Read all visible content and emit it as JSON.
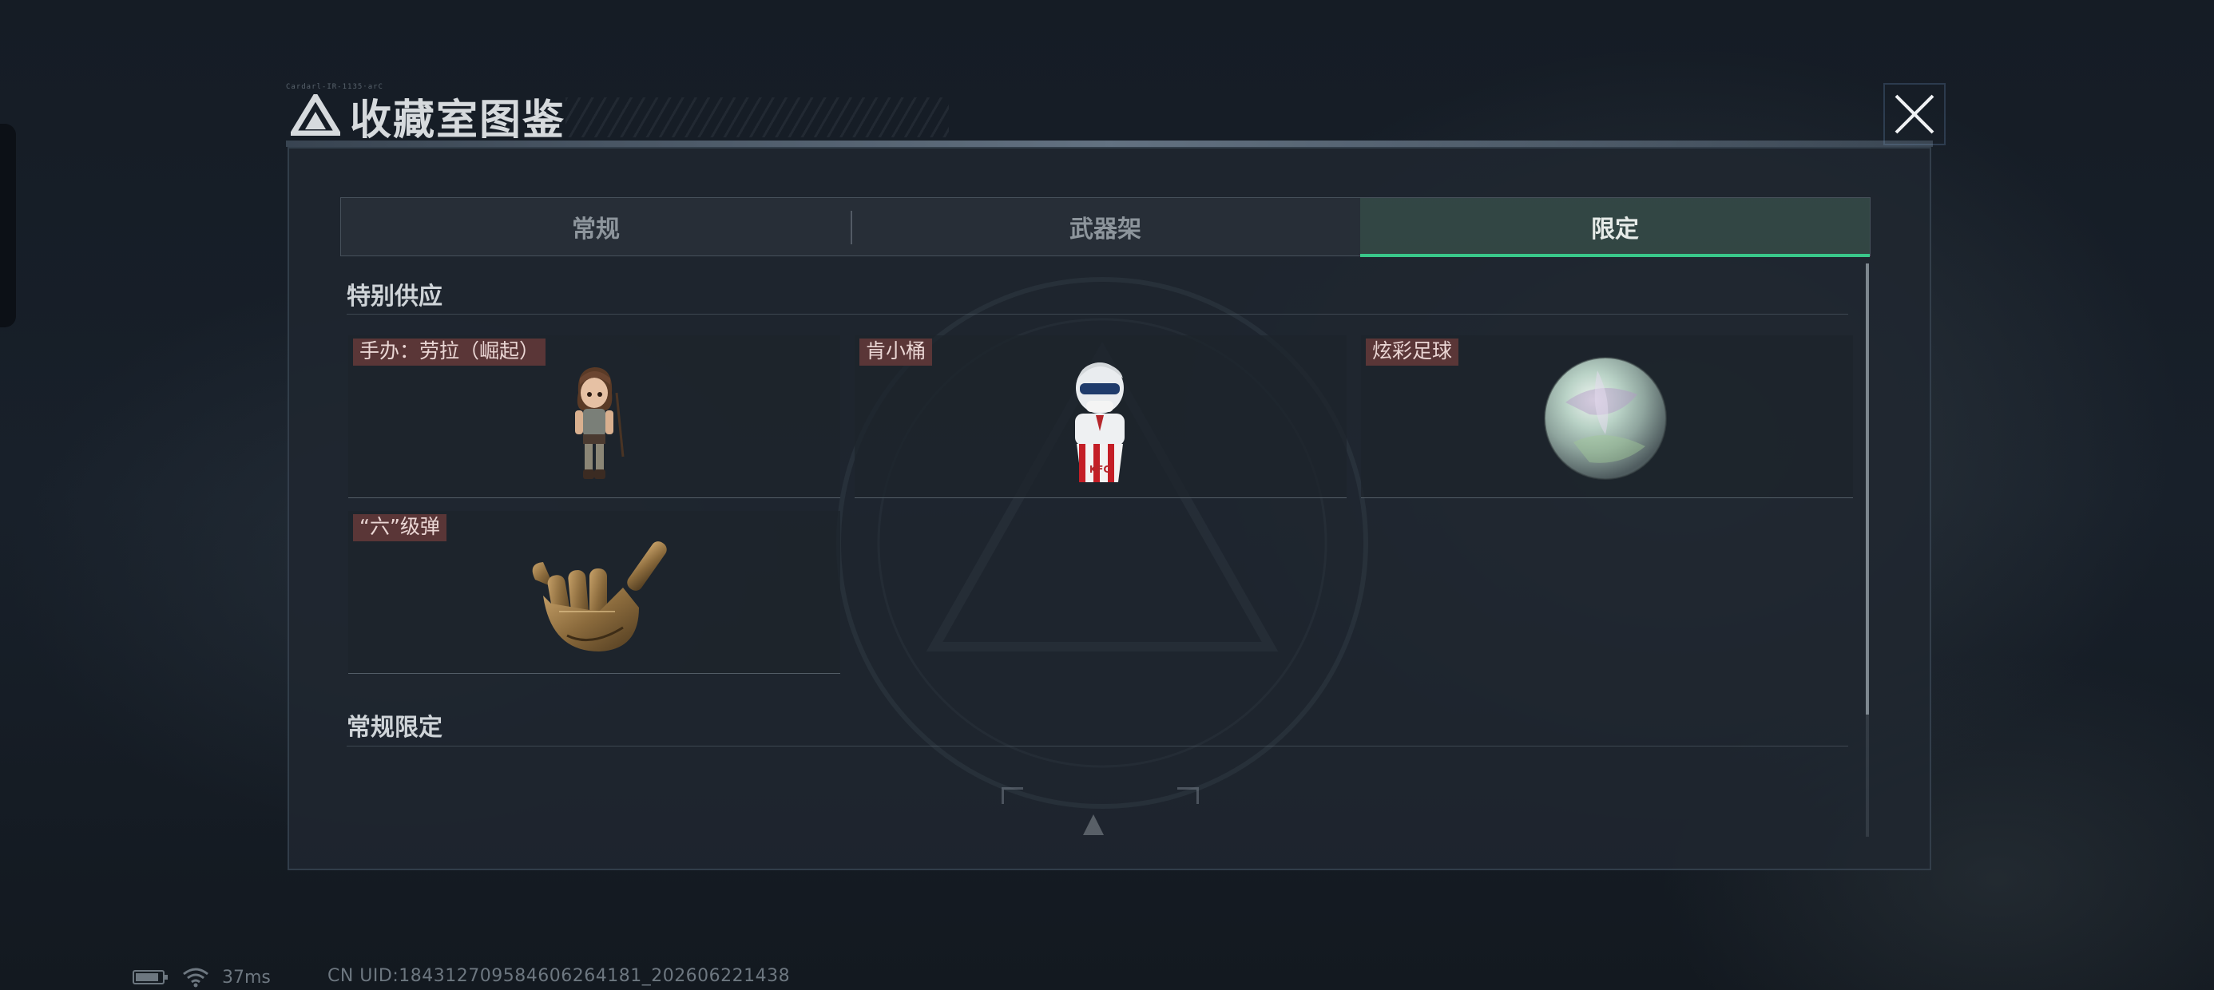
{
  "dialog": {
    "title": "收藏室图鉴",
    "deco_text": "Cardarl-IR-1135·arC",
    "close_icon": "close-icon",
    "logo_icon": "delta-triangle-icon"
  },
  "tabs": [
    {
      "label": "常规",
      "active": false
    },
    {
      "label": "武器架",
      "active": false
    },
    {
      "label": "限定",
      "active": true
    }
  ],
  "sections": {
    "special": {
      "title": "特别供应",
      "items": [
        {
          "label": "手办：劳拉（崛起）",
          "icon": "lara-figurine-icon"
        },
        {
          "label": "肯小桶",
          "icon": "kfc-bucket-figurine-icon"
        },
        {
          "label": "炫彩足球",
          "icon": "iridescent-football-icon"
        },
        {
          "label": "“六”级弹",
          "icon": "golden-hand-shaka-icon"
        }
      ]
    },
    "regular_limited": {
      "title": "常规限定"
    }
  },
  "status_bar": {
    "battery_icon": "battery-icon",
    "wifi_icon": "wifi-icon",
    "ping": "37ms",
    "uid": "CN UID:1843127095846062641​81_202606221438"
  },
  "colors": {
    "accent_green": "#39c88a",
    "label_bg": "#5a3637",
    "panel_bg": "#1f2730"
  }
}
